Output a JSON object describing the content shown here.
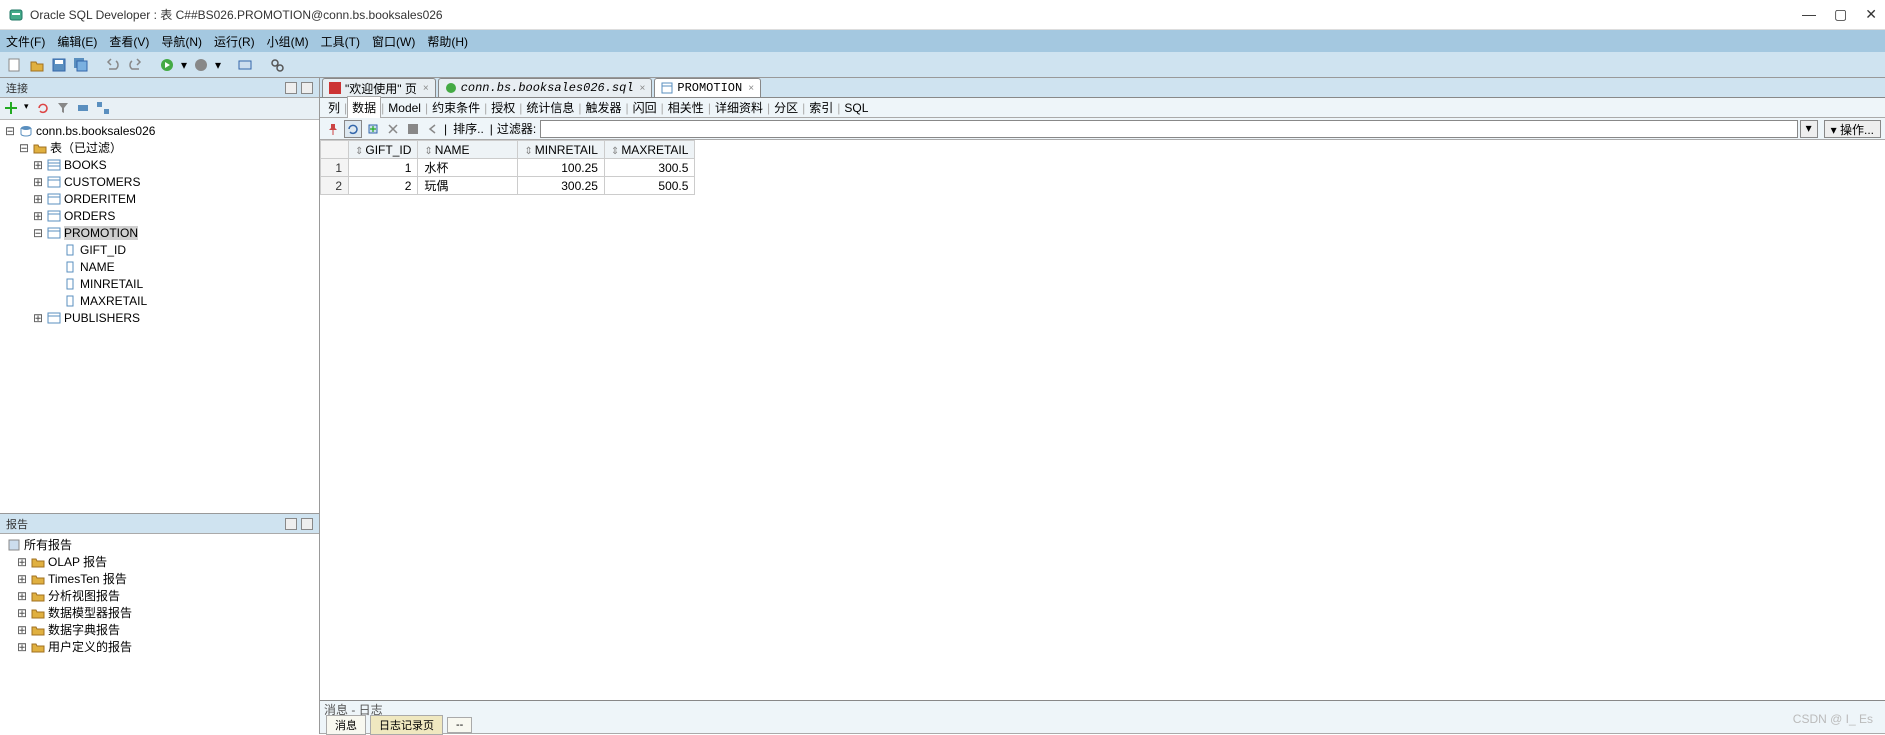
{
  "window": {
    "title": "Oracle SQL Developer : 表 C##BS026.PROMOTION@conn.bs.booksales026"
  },
  "menu": [
    "文件(F)",
    "编辑(E)",
    "查看(V)",
    "导航(N)",
    "运行(R)",
    "小组(M)",
    "工具(T)",
    "窗口(W)",
    "帮助(H)"
  ],
  "panels": {
    "connections_title": "连接",
    "reports_title": "报告"
  },
  "conn_tree": {
    "root": "conn.bs.booksales026",
    "tables_filter": "表（已过滤）",
    "tables": [
      "BOOKS",
      "CUSTOMERS",
      "ORDERITEM",
      "ORDERS",
      "PROMOTION",
      "PUBLISHERS"
    ],
    "promotion_cols": [
      "GIFT_ID",
      "NAME",
      "MINRETAIL",
      "MAXRETAIL"
    ]
  },
  "reports": {
    "root": "所有报告",
    "items": [
      "OLAP 报告",
      "TimesTen 报告",
      "分析视图报告",
      "数据模型器报告",
      "数据字典报告",
      "用户定义的报告"
    ]
  },
  "tabs": {
    "welcome": "\"欢迎使用\" 页",
    "sqlfile": "conn.bs.booksales026.sql",
    "promotion": "PROMOTION"
  },
  "subtabs": [
    "列",
    "数据",
    "Model",
    "约束条件",
    "授权",
    "统计信息",
    "触发器",
    "闪回",
    "相关性",
    "详细资料",
    "分区",
    "索引",
    "SQL"
  ],
  "subtab_active": "数据",
  "datatoolbar": {
    "sort": "排序..",
    "filter_label": "过滤器:",
    "filter_value": "",
    "ops": "操作..."
  },
  "grid": {
    "columns": [
      "GIFT_ID",
      "NAME",
      "MINRETAIL",
      "MAXRETAIL"
    ],
    "rows": [
      {
        "n": 1,
        "GIFT_ID": "1",
        "NAME": "水杯",
        "MINRETAIL": "100.25",
        "MAXRETAIL": "300.5"
      },
      {
        "n": 2,
        "GIFT_ID": "2",
        "NAME": "玩偶",
        "MINRETAIL": "300.25",
        "MAXRETAIL": "500.5"
      }
    ]
  },
  "log": {
    "title": "消息 - 日志",
    "tabs": [
      "消息",
      "日志记录页",
      "--"
    ]
  },
  "watermark": "CSDN @           I_ Es"
}
